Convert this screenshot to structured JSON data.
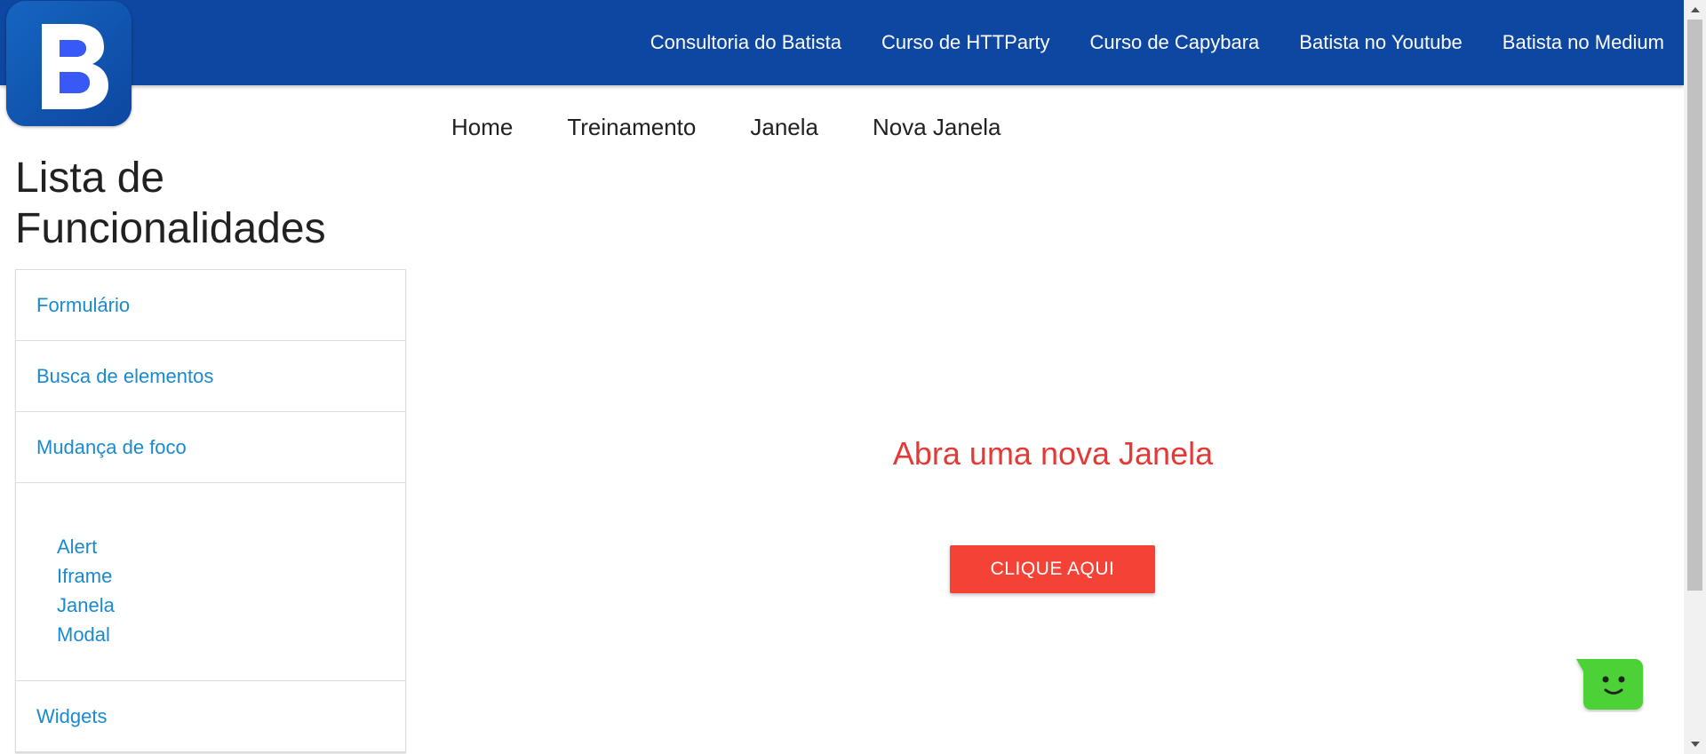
{
  "topnav": {
    "links": [
      "Consultoria do Batista",
      "Curso de HTTParty",
      "Curso de Capybara",
      "Batista no Youtube",
      "Batista no Medium"
    ],
    "color": "#0d47a1"
  },
  "logo": {
    "letter": "B",
    "icon": "logo-b-icon"
  },
  "subnav": {
    "links": [
      "Home",
      "Treinamento",
      "Janela",
      "Nova Janela"
    ]
  },
  "sidebar": {
    "title": "Lista de Funcionalidades",
    "items": [
      "Formulário",
      "Busca de elementos",
      "Mudança de foco"
    ],
    "subitems": [
      "Alert",
      "Iframe",
      "Janela",
      "Modal"
    ],
    "last_item": "Widgets"
  },
  "main": {
    "headline": "Abra uma nova Janela",
    "button": "CLIQUE AQUI",
    "accent": "#f44336"
  },
  "chat_widget": {
    "icon": "chat-face-icon",
    "color": "#4cd137"
  }
}
